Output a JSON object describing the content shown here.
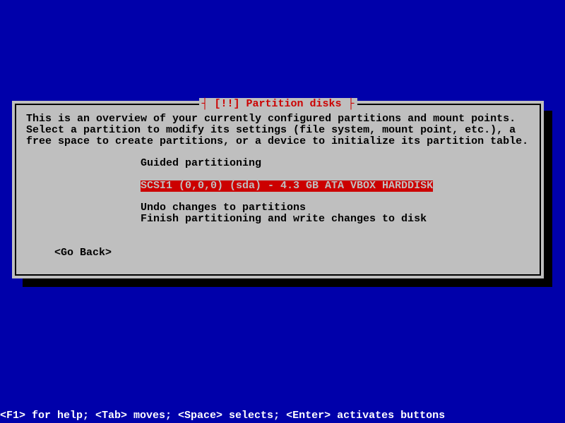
{
  "dialog": {
    "title": "[!!] Partition disks",
    "intro": "This is an overview of your currently configured partitions and mount points. Select a partition to modify its settings (file system, mount point, etc.), a free space to create partitions, or a device to initialize its partition table.",
    "menu": {
      "guided": "Guided partitioning",
      "disk": "SCSI1 (0,0,0) (sda) - 4.3 GB ATA VBOX HARDDISK",
      "undo": "Undo changes to partitions",
      "finish": "Finish partitioning and write changes to disk"
    },
    "go_back": "<Go Back>"
  },
  "footer": "<F1> for help; <Tab> moves; <Space> selects; <Enter> activates buttons"
}
